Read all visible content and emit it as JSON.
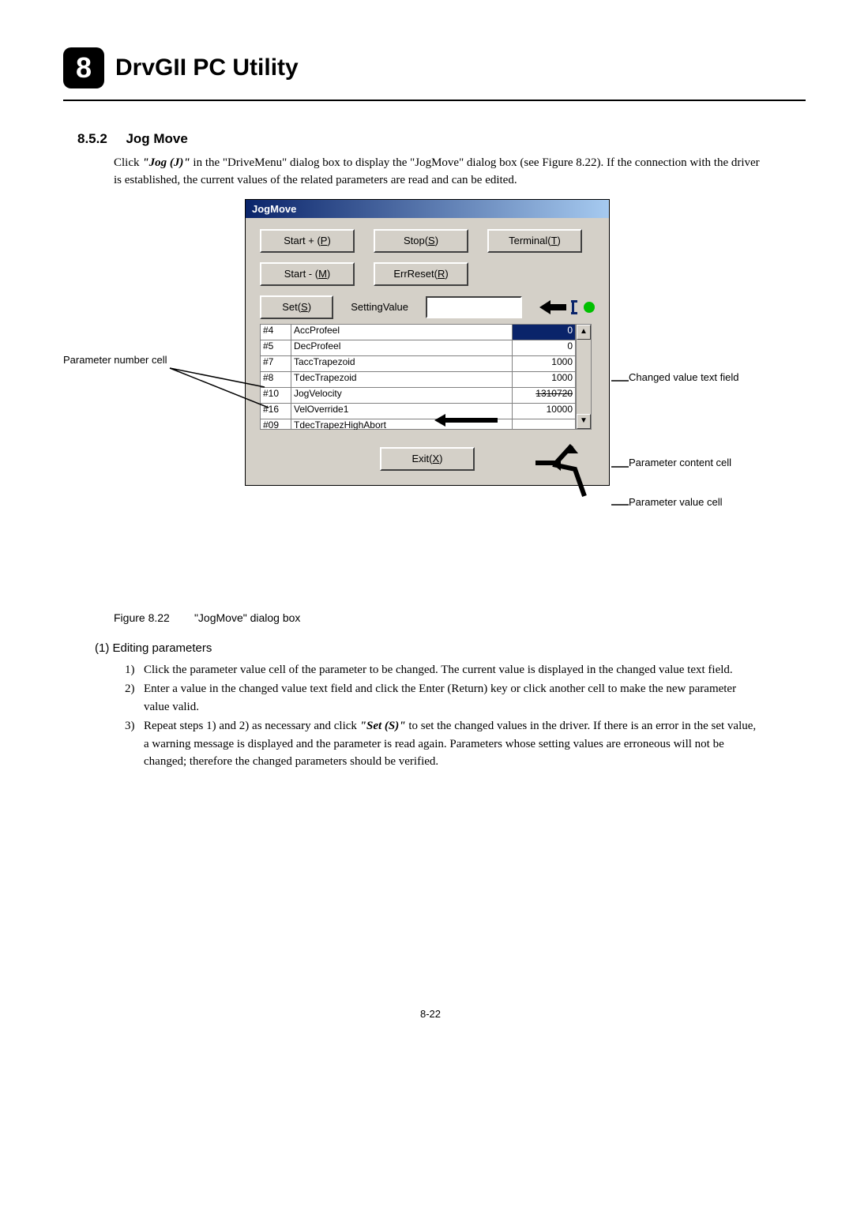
{
  "chapter": {
    "number": "8",
    "title": "DrvGII PC Utility"
  },
  "section": {
    "number": "8.5.2",
    "title": "Jog Move"
  },
  "intro": "Click \"Jog (J)\" in the \"DriveMenu\" dialog box to display the \"JogMove\" dialog box (see Figure 8.22). If the connection with the driver is established, the current values of the related parameters are read and can be edited.",
  "dialog": {
    "title": "JogMove",
    "buttons": {
      "start_plus": "Start + (P)",
      "start_minus": "Start - (M)",
      "stop": "Stop(S)",
      "err_reset": "ErrReset(R)",
      "terminal": "Terminal(T)",
      "set": "Set(S)",
      "exit": "Exit(X)"
    },
    "setting_label": "SettingValue",
    "params": [
      {
        "num": "#4",
        "name": "AccProfeel",
        "val": "0",
        "sel": true
      },
      {
        "num": "#5",
        "name": "DecProfeel",
        "val": "0",
        "sel": false
      },
      {
        "num": "#7",
        "name": "TaccTrapezoid",
        "val": "1000",
        "sel": false
      },
      {
        "num": "#8",
        "name": "TdecTrapezoid",
        "val": "1000",
        "sel": false
      },
      {
        "num": "#10",
        "name": "JogVelocity",
        "val": "1310720",
        "sel": false,
        "strike_val": true
      },
      {
        "num": "#16",
        "name": "VelOverride1",
        "val": "10000",
        "sel": false
      },
      {
        "num": "#09",
        "name": "TdecTrapezHighAbort",
        "val": "",
        "sel": false,
        "clipped": true
      }
    ]
  },
  "annotations": {
    "param_number_cell": "Parameter number cell",
    "changed_value_text": "Changed value text field",
    "param_content_cell": "Parameter content cell",
    "param_value_cell": "Parameter value cell"
  },
  "figure": {
    "label": "Figure 8.22",
    "caption": "\"JogMove\" dialog box"
  },
  "editing": {
    "heading": "(1)   Editing parameters",
    "items": [
      "Click the parameter value cell of the parameter to be changed. The current value is displayed in the changed value text field.",
      "Enter a value in the changed value text field and click the Enter (Return) key or click another cell to make the new parameter value valid.",
      "Repeat steps 1) and 2) as necessary and click \"Set (S)\" to set the changed values in the driver. If there is an error in the set value, a warning message is displayed and the parameter is read again. Parameters whose setting values are erroneous will not be changed; therefore the changed parameters should be verified."
    ]
  },
  "page_number": "8-22"
}
